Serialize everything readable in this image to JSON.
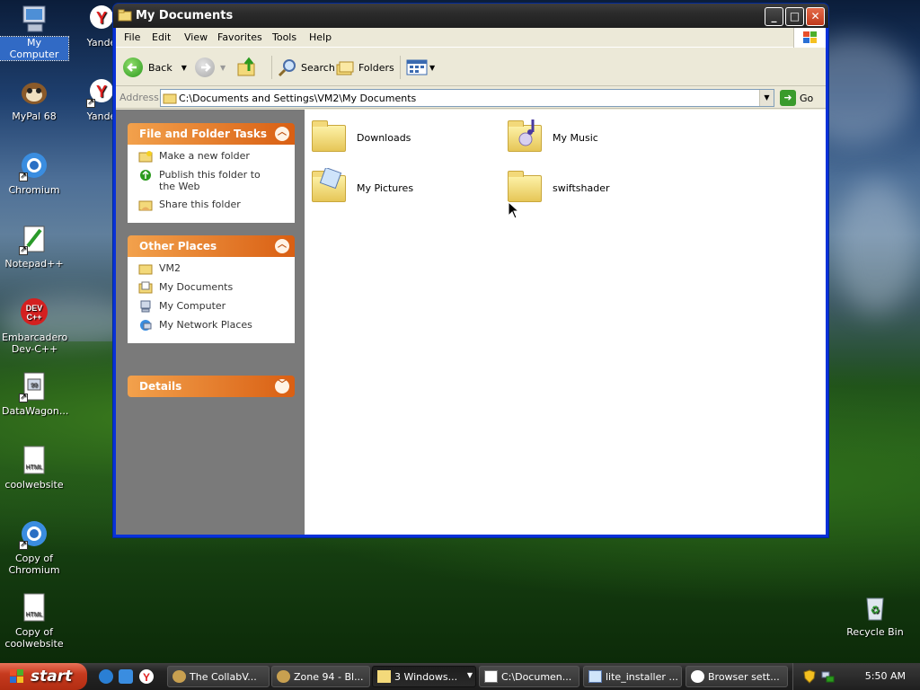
{
  "desktop": {
    "icons": [
      {
        "label": "My Computer"
      },
      {
        "label": "Yande"
      },
      {
        "label": "MyPal 68"
      },
      {
        "label": "Yande"
      },
      {
        "label": "Chromium"
      },
      {
        "label": "Notepad++"
      },
      {
        "label": "Embarcadero Dev-C++"
      },
      {
        "label": "DataWagon...",
        "glyph": "99"
      },
      {
        "label": "coolwebsite",
        "glyph": "HTML"
      },
      {
        "label": "Copy of Chromium"
      },
      {
        "label": "Copy of coolwebsite",
        "glyph": "HTML"
      },
      {
        "label": "Recycle Bin"
      }
    ]
  },
  "window": {
    "title": "My Documents",
    "menu": [
      "File",
      "Edit",
      "View",
      "Favorites",
      "Tools",
      "Help"
    ],
    "toolbar": {
      "back": "Back",
      "search": "Search",
      "folders": "Folders"
    },
    "address": {
      "label": "Address",
      "value": "C:\\Documents and Settings\\VM2\\My Documents",
      "go": "Go"
    },
    "tasks_panel": {
      "title": "File and Folder Tasks",
      "items": [
        "Make a new folder",
        "Publish this folder to the Web",
        "Share this folder"
      ]
    },
    "places_panel": {
      "title": "Other Places",
      "items": [
        "VM2",
        "My Documents",
        "My Computer",
        "My Network Places"
      ]
    },
    "details_panel": {
      "title": "Details"
    },
    "files": [
      "Downloads",
      "My Music",
      "My Pictures",
      "swiftshader"
    ]
  },
  "taskbar": {
    "start": "start",
    "tasks": [
      "The CollabV...",
      "Zone 94 - Bl...",
      "3 Windows...",
      "C:\\Documen...",
      "lite_installer ...",
      "Browser sett..."
    ],
    "clock": "5:50 AM"
  },
  "colors": {
    "title_bar": "#2b2b2b",
    "panel_header": "#d95f13",
    "selection": "#316ac5",
    "start_button": "#c63a1e"
  }
}
